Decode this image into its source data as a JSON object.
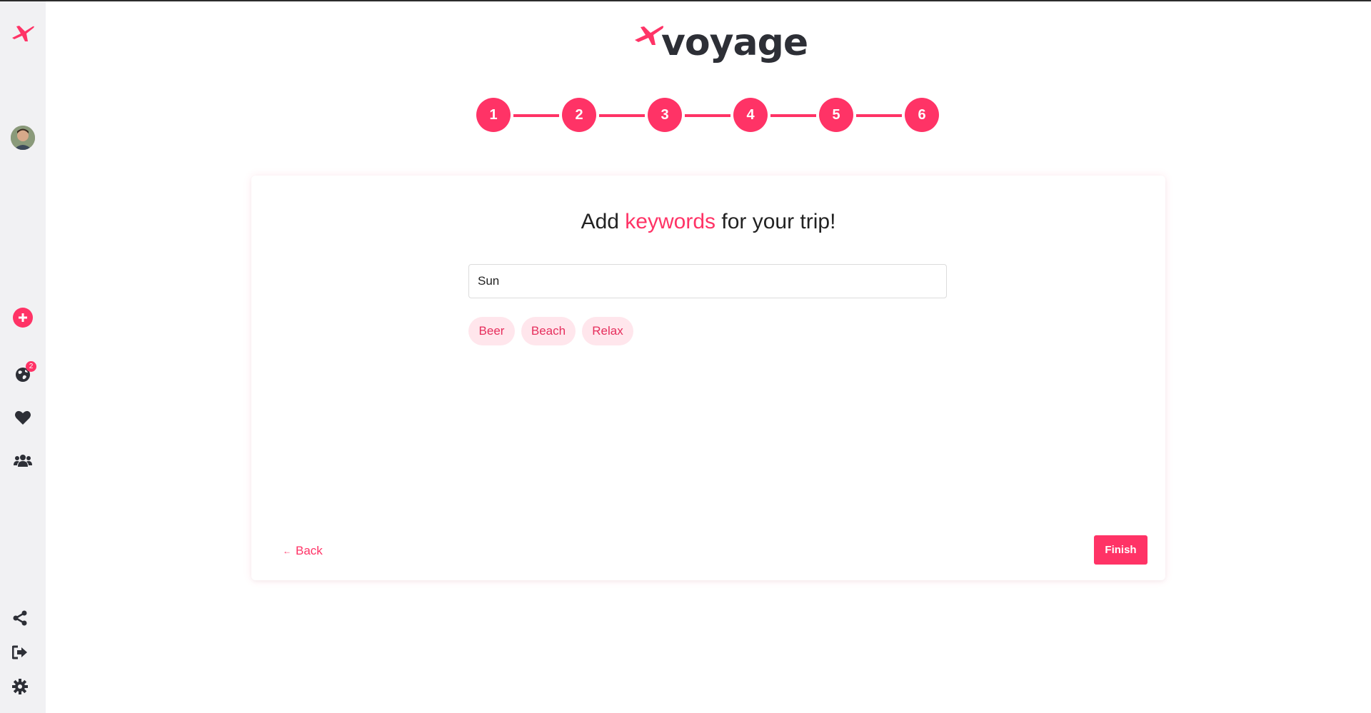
{
  "app": {
    "logo_text": "voyage",
    "brand_color": "#ff3366"
  },
  "sidebar": {
    "top_icon": "plane-icon",
    "items": [
      {
        "name": "add-trip",
        "icon": "plus-circle-icon"
      },
      {
        "name": "trips",
        "icon": "globe-icon",
        "badge": "2"
      },
      {
        "name": "favorites",
        "icon": "heart-icon"
      },
      {
        "name": "friends",
        "icon": "users-icon"
      },
      {
        "name": "share",
        "icon": "share-icon"
      },
      {
        "name": "logout",
        "icon": "logout-icon"
      },
      {
        "name": "settings",
        "icon": "gear-icon"
      }
    ]
  },
  "stepper": {
    "steps": [
      "1",
      "2",
      "3",
      "4",
      "5",
      "6"
    ]
  },
  "card": {
    "heading_before": "Add",
    "heading_accent": "keywords",
    "heading_after": "for your trip!",
    "input_value": "Sun",
    "chips": [
      "Beer",
      "Beach",
      "Relax"
    ],
    "back_label": "Back",
    "back_arrow": "←",
    "finish_label": "Finish"
  }
}
